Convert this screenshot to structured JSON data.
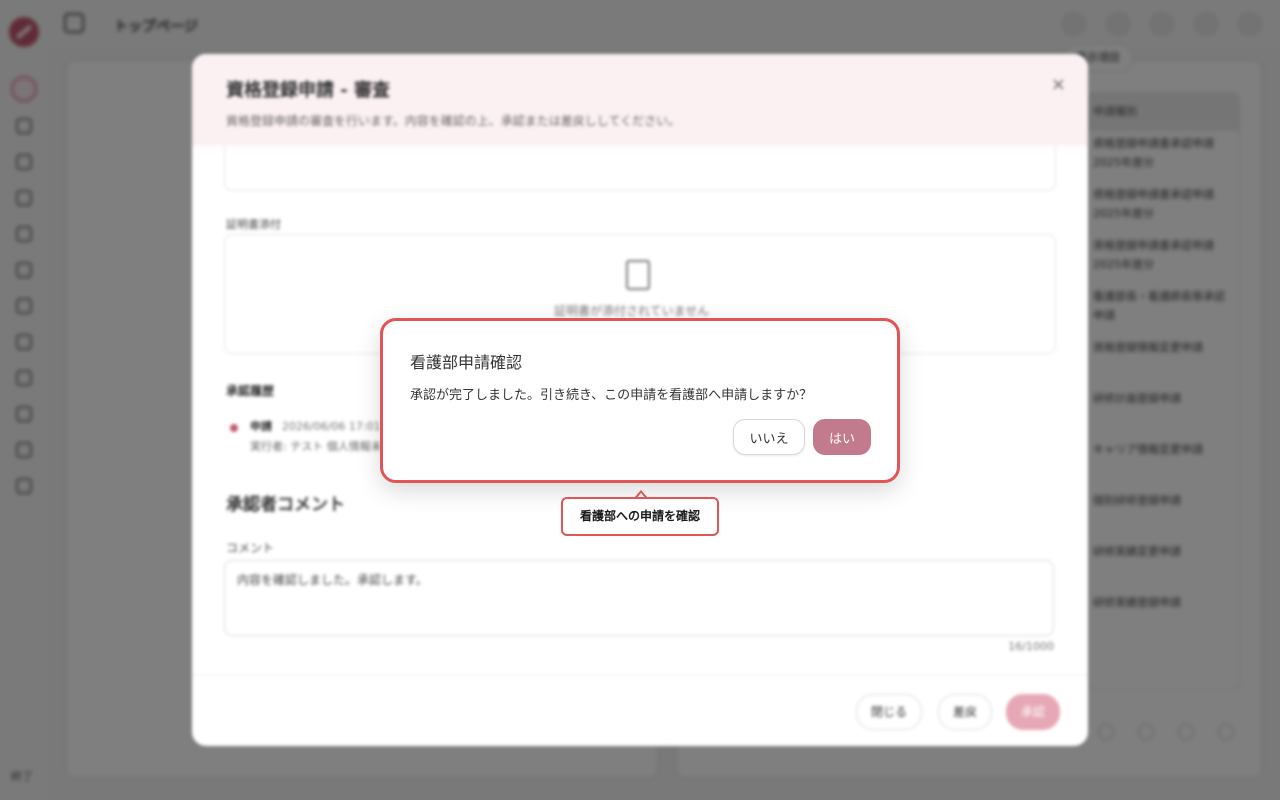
{
  "app": {
    "breadcrumb": "トップページ",
    "sidebar_footer": "終了"
  },
  "background": {
    "filter_chip": "表示項目",
    "list_header": "申請種別",
    "list_items": [
      "資格登録申請書承認申請 2025年度分",
      "資格登録申請書承認申請 2025年度分",
      "資格登録申請書承認申請 2025年度分",
      "看護部長・看護師長等承認申請",
      "資格登録情報変更申請",
      "研修計画登録申請",
      "キャリア情報変更申請",
      "個別研修登録申請",
      "研修実績変更申請",
      "研修実績登録申請"
    ]
  },
  "review_modal": {
    "title": "資格登録申請 - 審査",
    "subtitle": "資格登録申請の審査を行います。内容を確認の上、承認または差戻ししてください。",
    "close": "×",
    "attachment_label": "証明書添付",
    "attachment_empty": "証明書が添付されていません",
    "history_title": "承認履歴",
    "history": {
      "status": "申請",
      "date": "2026/06/06 17:01",
      "actor": "実行者: テスト 個人情報未設定"
    },
    "comment_section_title": "承認者コメント",
    "comment_label": "コメント",
    "comment_value": "内容を確認しました。承認します。",
    "char_count": "16/1000",
    "buttons": {
      "close": "閉じる",
      "reject": "差戻",
      "approve": "承認"
    }
  },
  "confirm_dialog": {
    "title": "看護部申請確認",
    "message": "承認が完了しました。引き続き、この申請を看護部へ申請しますか？",
    "no_label": "いいえ",
    "yes_label": "はい"
  },
  "tooltip": {
    "text": "看護部への申請を確認"
  },
  "colors": {
    "accent": "#c27b8c",
    "highlight": "#e05555"
  }
}
